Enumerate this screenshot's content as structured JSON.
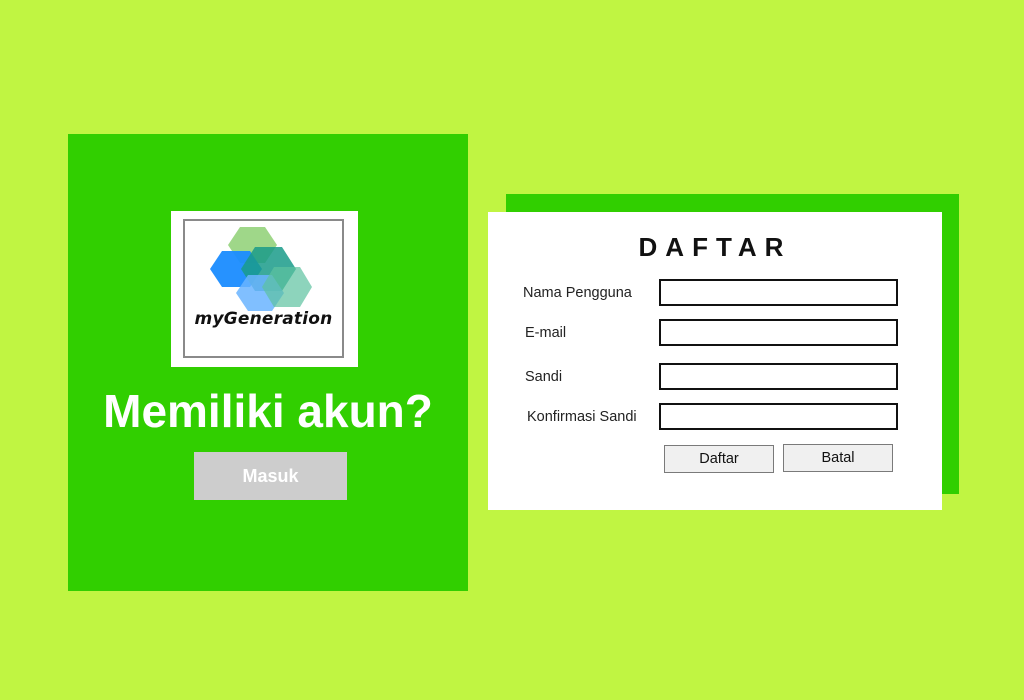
{
  "colors": {
    "background": "#c0f542",
    "panel_green": "#31cf00",
    "card_white": "#ffffff",
    "masuk_button": "#cdcdcd"
  },
  "left_panel": {
    "logo": {
      "text": "myGeneration",
      "icon": "hexagon-logo-icon"
    },
    "heading": "Memiliki akun?",
    "login_button_label": "Masuk"
  },
  "register_form": {
    "title": "DAFTAR",
    "fields": [
      {
        "label": "Nama Pengguna",
        "value": "",
        "placeholder": ""
      },
      {
        "label": "E-mail",
        "value": "",
        "placeholder": ""
      },
      {
        "label": "Sandi",
        "value": "",
        "placeholder": ""
      },
      {
        "label": "Konfirmasi Sandi",
        "value": "",
        "placeholder": ""
      }
    ],
    "submit_label": "Daftar",
    "cancel_label": "Batal"
  }
}
